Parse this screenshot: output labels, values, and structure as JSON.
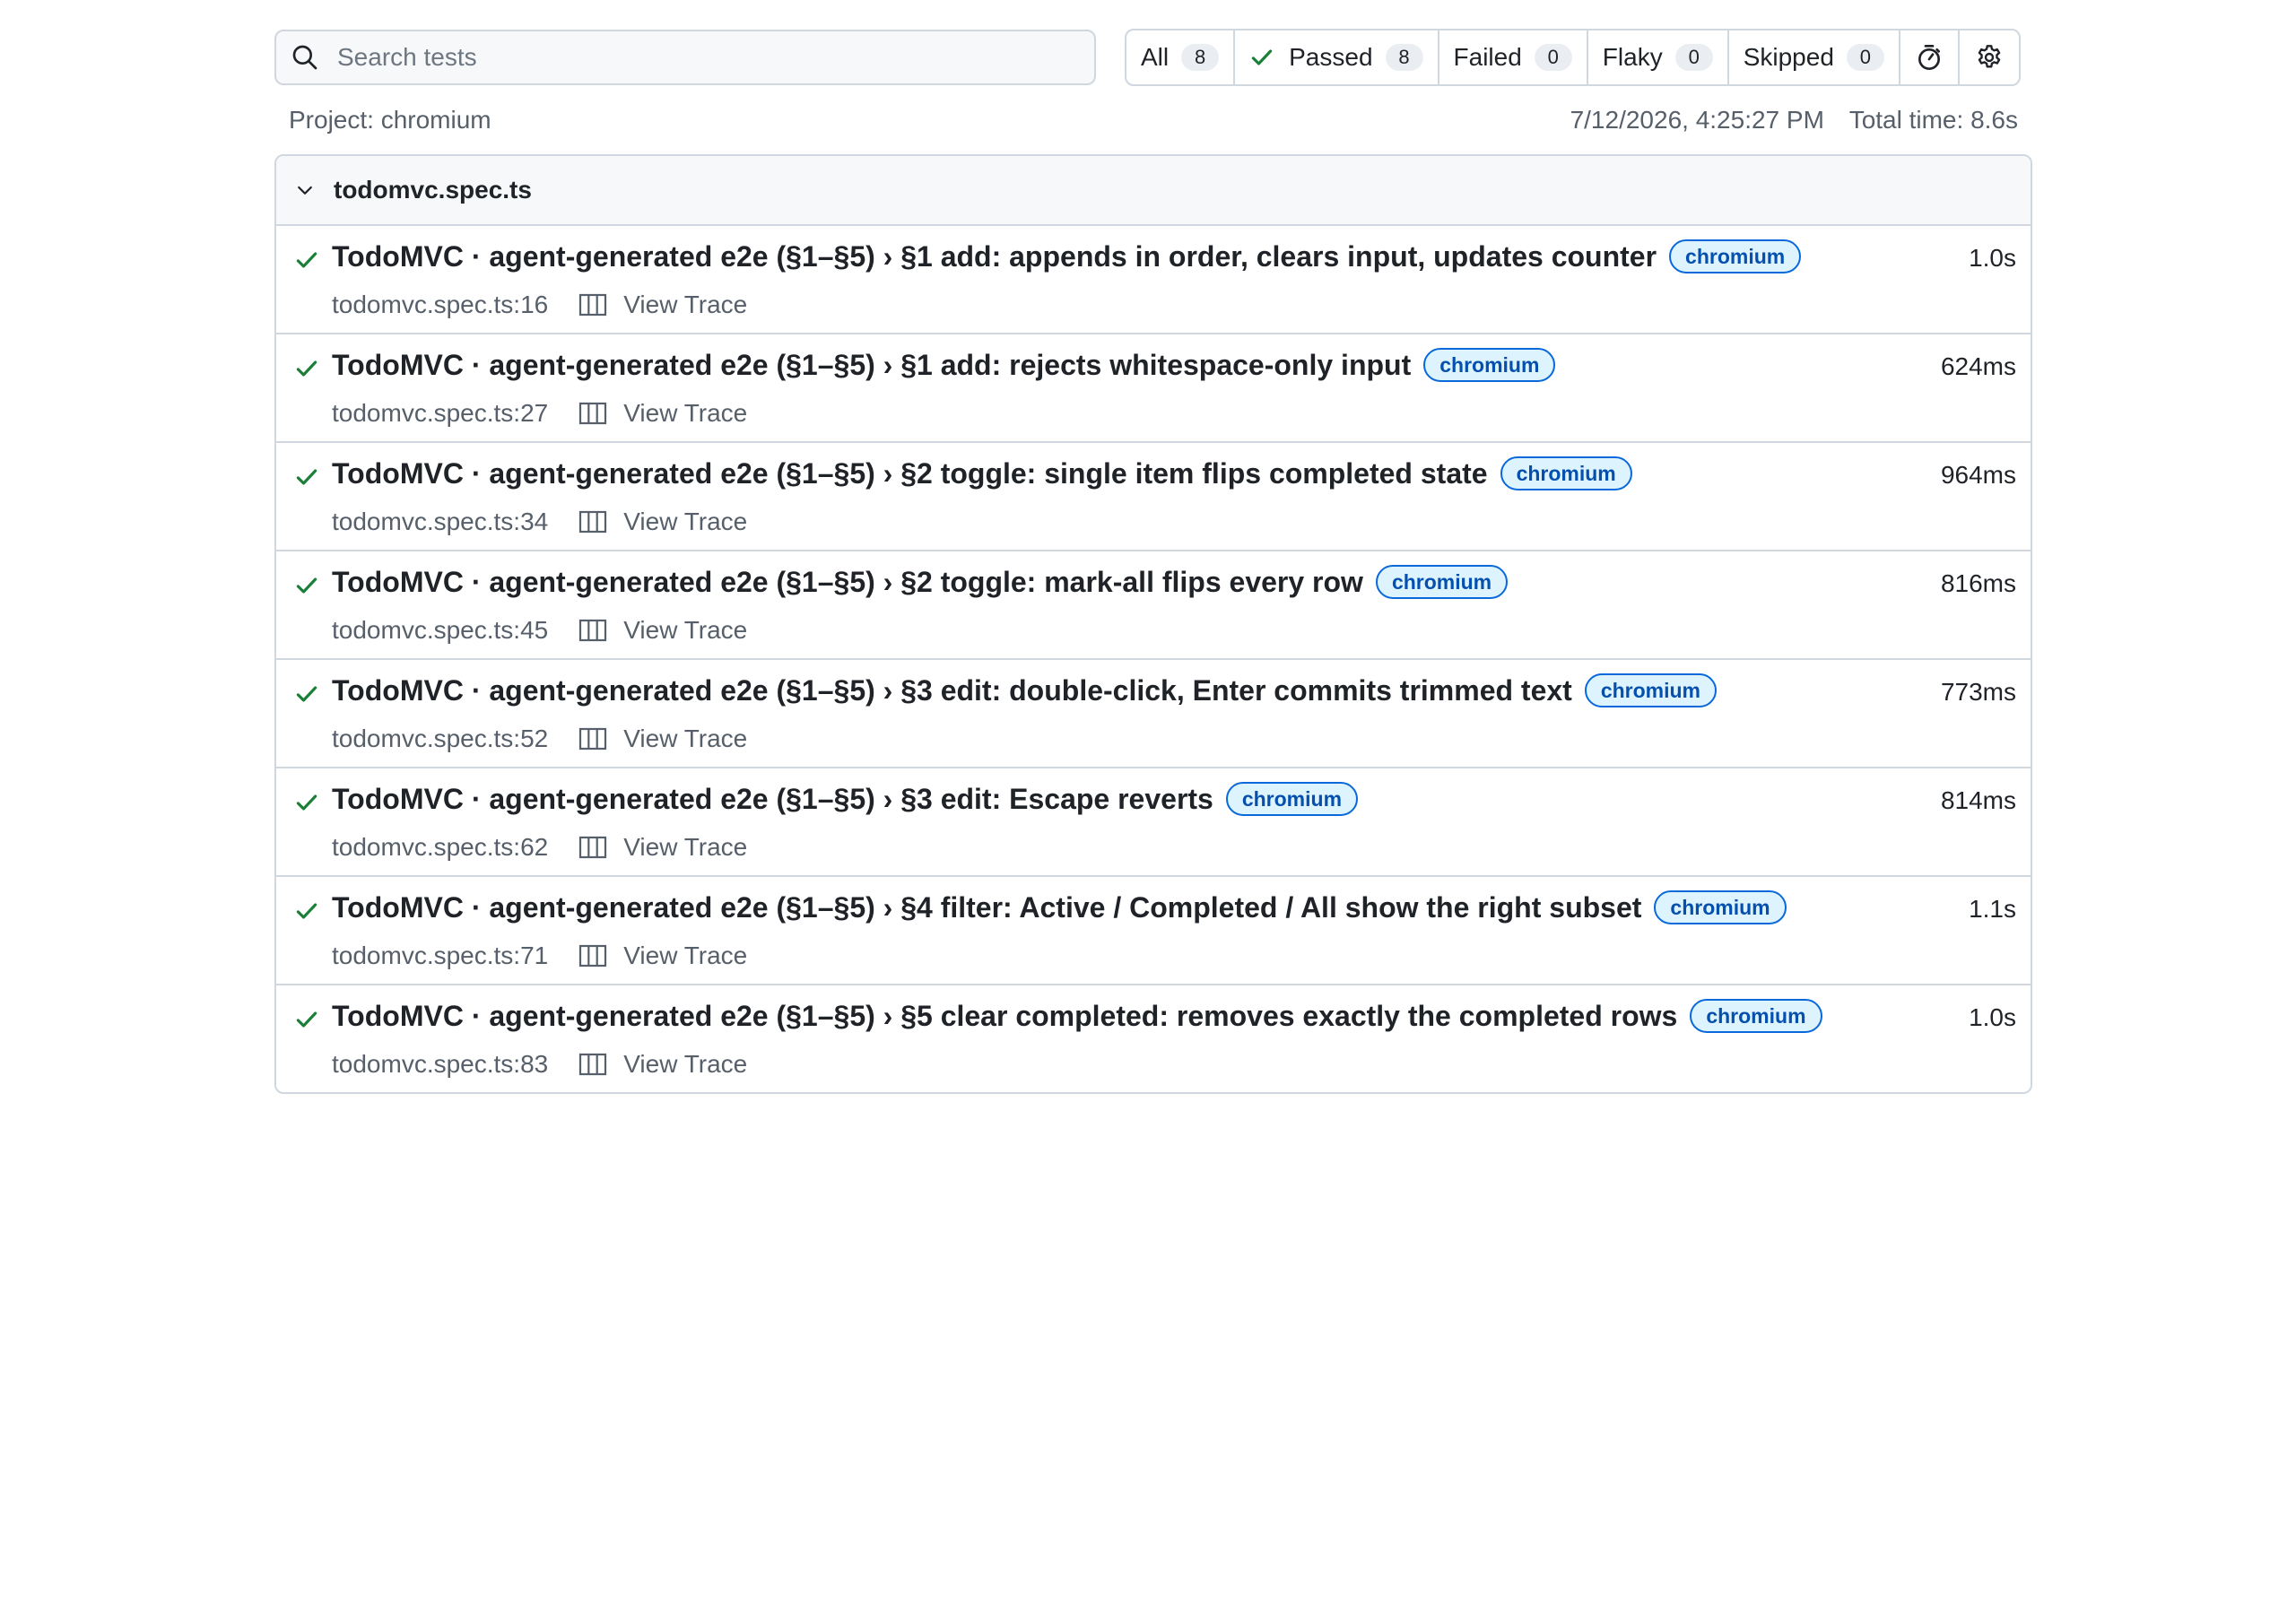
{
  "search": {
    "placeholder": "Search tests",
    "value": ""
  },
  "filters": [
    {
      "label": "All",
      "count": "8"
    },
    {
      "label": "Passed",
      "count": "8",
      "icon": "check-icon"
    },
    {
      "label": "Failed",
      "count": "0"
    },
    {
      "label": "Flaky",
      "count": "0"
    },
    {
      "label": "Skipped",
      "count": "0"
    }
  ],
  "toolbar_icons": [
    "stopwatch-icon",
    "gear-icon"
  ],
  "meta": {
    "project": "Project: chromium",
    "timestamp": "7/12/2026, 4:25:27 PM",
    "total_time": "Total time: 8.6s"
  },
  "group": {
    "title": "todomvc.spec.ts",
    "expanded": true
  },
  "tests": [
    {
      "name": "TodoMVC · agent-generated e2e (§1–§5) › §1 add: appends in order, clears input, updates counter",
      "tag": "chromium",
      "duration": "1.0s",
      "location": "todomvc.spec.ts:16",
      "trace": "View Trace"
    },
    {
      "name": "TodoMVC · agent-generated e2e (§1–§5) › §1 add: rejects whitespace-only input",
      "tag": "chromium",
      "duration": "624ms",
      "location": "todomvc.spec.ts:27",
      "trace": "View Trace"
    },
    {
      "name": "TodoMVC · agent-generated e2e (§1–§5) › §2 toggle: single item flips completed state",
      "tag": "chromium",
      "duration": "964ms",
      "location": "todomvc.spec.ts:34",
      "trace": "View Trace"
    },
    {
      "name": "TodoMVC · agent-generated e2e (§1–§5) › §2 toggle: mark-all flips every row",
      "tag": "chromium",
      "duration": "816ms",
      "location": "todomvc.spec.ts:45",
      "trace": "View Trace"
    },
    {
      "name": "TodoMVC · agent-generated e2e (§1–§5) › §3 edit: double-click, Enter commits trimmed text",
      "tag": "chromium",
      "duration": "773ms",
      "location": "todomvc.spec.ts:52",
      "trace": "View Trace"
    },
    {
      "name": "TodoMVC · agent-generated e2e (§1–§5) › §3 edit: Escape reverts",
      "tag": "chromium",
      "duration": "814ms",
      "location": "todomvc.spec.ts:62",
      "trace": "View Trace"
    },
    {
      "name": "TodoMVC · agent-generated e2e (§1–§5) › §4 filter: Active / Completed / All show the right subset",
      "tag": "chromium",
      "duration": "1.1s",
      "location": "todomvc.spec.ts:71",
      "trace": "View Trace"
    },
    {
      "name": "TodoMVC · agent-generated e2e (§1–§5) › §5 clear completed: removes exactly the completed rows",
      "tag": "chromium",
      "duration": "1.0s",
      "location": "todomvc.spec.ts:83",
      "trace": "View Trace"
    }
  ],
  "colors": {
    "pass": "#1a7f37",
    "border": "#d0d7de",
    "tag_text": "#0550ae",
    "tag_bg": "#ddf4ff",
    "tag_border": "#0969da",
    "muted": "#57606a"
  }
}
